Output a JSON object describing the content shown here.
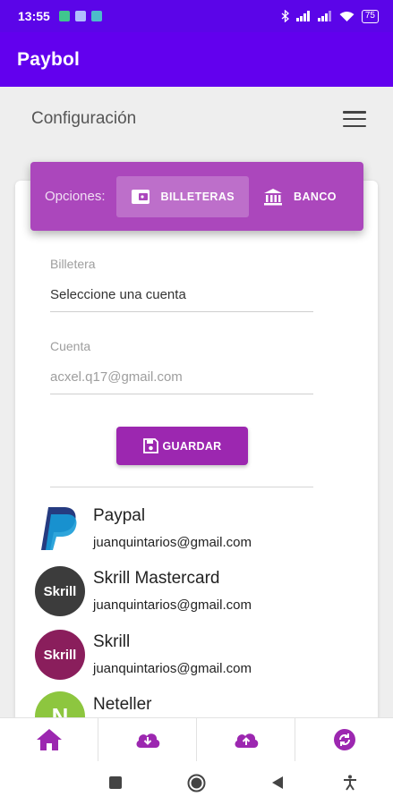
{
  "status_bar": {
    "time": "13:55",
    "battery": "75"
  },
  "app_bar": {
    "title": "Paybol"
  },
  "header": {
    "title": "Configuración",
    "menu_icon": "hamburger-menu-icon"
  },
  "options": {
    "label": "Opciones:",
    "tabs": [
      {
        "label": "BILLETERAS",
        "icon": "wallet-icon",
        "active": true
      },
      {
        "label": "BANCO",
        "icon": "bank-icon",
        "active": false
      }
    ]
  },
  "form": {
    "wallet": {
      "label": "Billetera",
      "value": "Seleccione una cuenta"
    },
    "account": {
      "label": "Cuenta",
      "placeholder": "acxel.q17@gmail.com"
    },
    "save_label": "GUARDAR"
  },
  "accounts": [
    {
      "name": "Paypal",
      "email": "juanquintarios@gmail.com",
      "logo": "paypal-logo"
    },
    {
      "name": "Skrill Mastercard",
      "email": "juanquintarios@gmail.com",
      "logo": "skrill-logo",
      "logo_text": "Skrill",
      "color": "#3c3c3c"
    },
    {
      "name": "Skrill",
      "email": "juanquintarios@gmail.com",
      "logo": "skrill-logo",
      "logo_text": "Skrill",
      "color": "#8a1e5c"
    },
    {
      "name": "Neteller",
      "email": "",
      "logo": "neteller-logo",
      "logo_text": "N",
      "color": "#8dc63f"
    }
  ],
  "bottom_nav": [
    {
      "icon": "home-icon"
    },
    {
      "icon": "cloud-download-icon"
    },
    {
      "icon": "cloud-upload-icon"
    },
    {
      "icon": "sync-icon"
    }
  ],
  "colors": {
    "primary": "#6200ee",
    "status_bar": "#5b05e8",
    "accent": "#9c27b0",
    "options_bg": "#ab47bc"
  }
}
